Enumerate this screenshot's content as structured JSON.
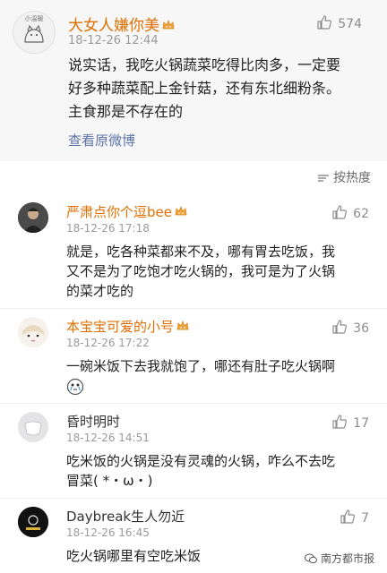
{
  "post": {
    "avatar_text": "小温暖",
    "username": "大女人嫌你美",
    "time": "18-12-26 12:44",
    "likes": "574",
    "lines": [
      "说实话，我吃火锅蔬菜吃得比肉多，一定要",
      "好多种蔬菜配上金针菇，还有东北细粉条。",
      "主食那是不存在的"
    ],
    "view_original": "查看原微博"
  },
  "sort_label": "按热度",
  "comments": [
    {
      "username": "严肃点你个逗bee",
      "time": "18-12-26 17:18",
      "likes": "62",
      "lines": [
        "就是，吃各种菜都来不及，哪有胃去吃饭，我",
        "又不是为了吃饱才吃火锅的，我可是为了火锅",
        "的菜才吃的"
      ]
    },
    {
      "username": "本宝宝可爱的小号",
      "time": "18-12-26 17:22",
      "likes": "36",
      "lines": [
        "一碗米饭下去我就饱了，哪还有肚子吃火锅啊"
      ]
    },
    {
      "username": "昏时明时",
      "time": "18-12-26 14:51",
      "likes": "17",
      "lines": [
        "吃米饭的火锅是没有灵魂的火锅，咋么不去吃",
        "冒菜( *・ω・)"
      ]
    },
    {
      "username": "Daybreak生人勿近",
      "time": "18-12-26 16:45",
      "likes": "7",
      "lines": [
        "吃火锅哪里有空吃米饭"
      ]
    }
  ],
  "watermark": "南方都市报",
  "colors": {
    "username": "#e06e00",
    "link": "#5c74a6",
    "post_bg": "#f7f7f7"
  }
}
